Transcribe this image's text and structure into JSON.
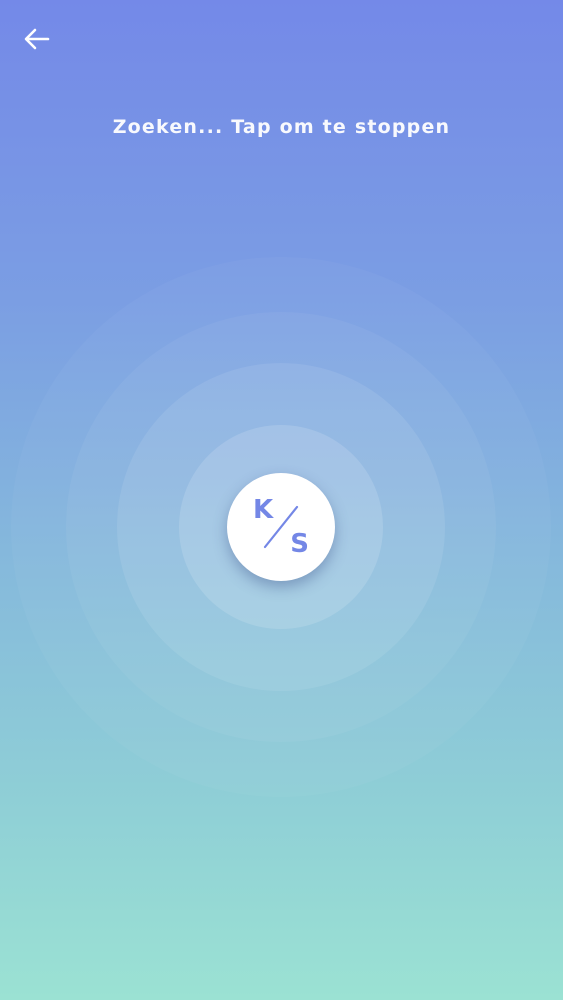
{
  "header": {
    "back_icon": "arrow-left-icon",
    "status_text": "Zoeken... Tap om te stoppen"
  },
  "scanner": {
    "logo": {
      "letter_top": "K",
      "letter_bottom": "S"
    }
  },
  "colors": {
    "gradient_top": "#7489e8",
    "gradient_bottom": "#9be2d3",
    "logo_accent": "#7487e6",
    "text": "#ffffff"
  }
}
